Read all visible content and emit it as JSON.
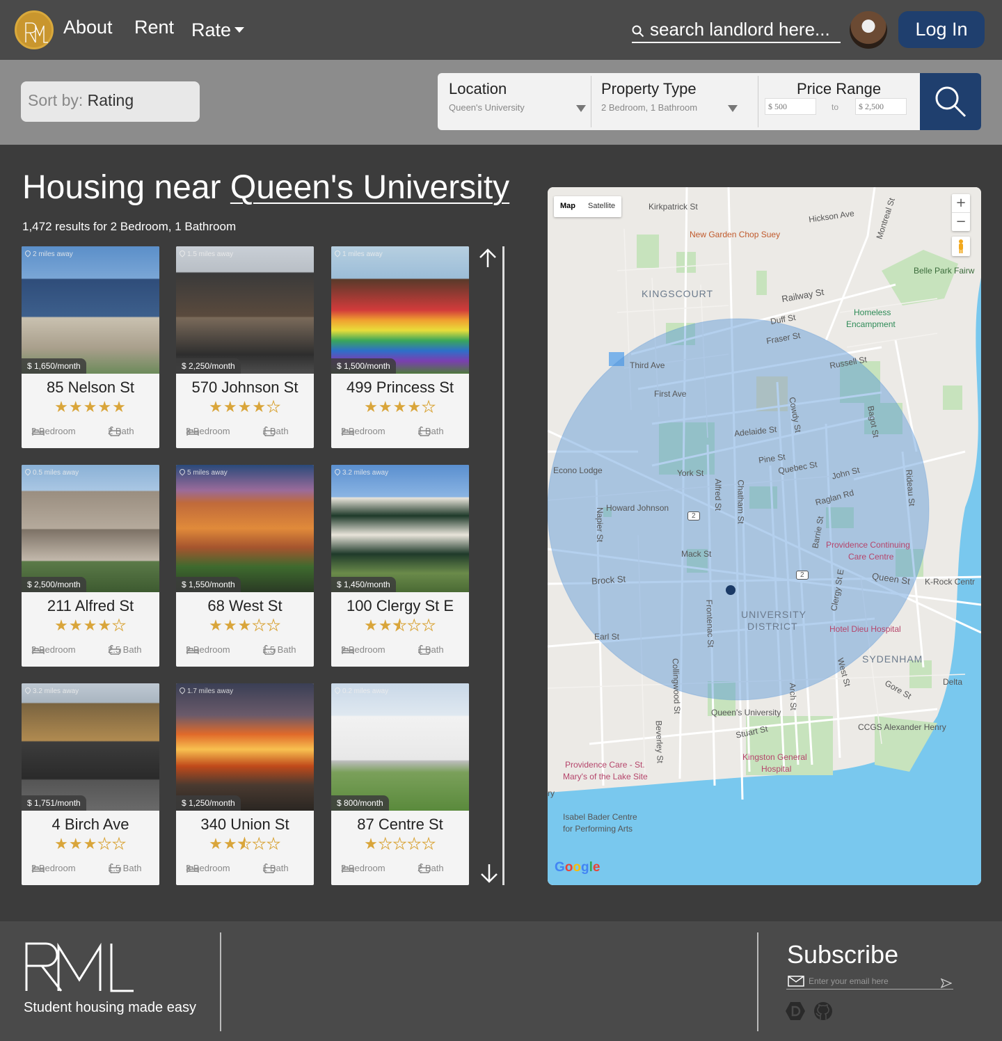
{
  "nav": {
    "links": [
      "About",
      "Rent",
      "Rate"
    ],
    "search_placeholder": "search landlord here...",
    "login_label": "Log In"
  },
  "filters": {
    "sort_prefix": "Sort by:",
    "sort_value": "Rating",
    "location_title": "Location",
    "location_value": "Queen's University",
    "property_title": "Property Type",
    "property_value": "2 Bedroom, 1 Bathroom",
    "price_title": "Price Range",
    "price_min": "$ 500",
    "price_to": "to",
    "price_max": "$ 2,500"
  },
  "main": {
    "title_prefix": "Housing near",
    "title_place": "Queen's University",
    "results": "1,472 results for 2 Bedroom, 1 Bathroom"
  },
  "listings": [
    {
      "address": "85 Nelson St",
      "distance": "2 miles away",
      "price": "$ 1,650/month",
      "rating": 5,
      "bedrooms": "2 Bedroom",
      "baths": "2 Bath"
    },
    {
      "address": "570 Johnson St",
      "distance": "1.5 miles away",
      "price": "$ 2,250/month",
      "rating": 4,
      "bedrooms": "3 Bedroom",
      "baths": "1 Bath"
    },
    {
      "address": "499 Princess St",
      "distance": "1 miles away",
      "price": "$ 1,500/month",
      "rating": 4,
      "bedrooms": "2 Bedroom",
      "baths": "1 Bath"
    },
    {
      "address": "211 Alfred St",
      "distance": "0.5 miles away",
      "price": "$ 2,500/month",
      "rating": 4,
      "bedrooms": "2 Bedroom",
      "baths": "2.5 Bath"
    },
    {
      "address": "68 West St",
      "distance": "5 miles away",
      "price": "$ 1,550/month",
      "rating": 3,
      "bedrooms": "2 Bedroom",
      "baths": "1.5 Bath"
    },
    {
      "address": "100 Clergy St E",
      "distance": "3.2 miles away",
      "price": "$ 1,450/month",
      "rating": 2.5,
      "bedrooms": "2 Bedroom",
      "baths": "1 Bath"
    },
    {
      "address": "4 Birch Ave",
      "distance": "3.2 miles away",
      "price": "$ 1,751/month",
      "rating": 3,
      "bedrooms": "2 Bedroom",
      "baths": "1.5 Bath"
    },
    {
      "address": "340 Union St",
      "distance": "1.7 miles away",
      "price": "$ 1,250/month",
      "rating": 2.5,
      "bedrooms": "3 Bedroom",
      "baths": "1 Bath"
    },
    {
      "address": "87 Centre St",
      "distance": "0.2 miles away",
      "price": "$ 800/month",
      "rating": 1,
      "bedrooms": "2 Bedroom",
      "baths": "2 Bath"
    }
  ],
  "map": {
    "toggle": [
      "Map",
      "Satellite"
    ],
    "labels": {
      "kirkpatrick": "Kirkpatrick St",
      "hickson": "Hickson Ave",
      "montreal": "Montreal St",
      "newgarden": "New Garden Chop Suey",
      "bellepark": "Belle Park Fairw",
      "kingscourt": "KINGSCOURT",
      "railway": "Railway St",
      "homeless1": "Homeless",
      "homeless2": "Encampment",
      "duff": "Duff St",
      "fraser": "Fraser St",
      "russell": "Russell St",
      "third": "Third Ave",
      "first": "First Ave",
      "cowdy": "Cowdy St",
      "bagot": "Bagot St",
      "adelaide": "Adelaide St",
      "econo": "Econo Lodge",
      "york": "York St",
      "pine": "Pine St",
      "quebec": "Quebec St",
      "john": "John St",
      "rideau": "Rideau St",
      "alfred": "Alfred St",
      "chatham": "Chatham St",
      "howard": "Howard Johnson",
      "raglan": "Raglan Rd",
      "napier": "Napier St",
      "barrie": "Barrie St",
      "providence1": "Providence Continuing",
      "providence2": "Care Centre",
      "mack": "Mack St",
      "queen": "Queen St",
      "krock": "K-Rock Centr",
      "brock": "Brock St",
      "clergy": "Clergy St E",
      "univ1": "UNIVERSITY",
      "univ2": "DISTRICT",
      "frontenac": "Frontenac St",
      "hoteldieu": "Hotel Dieu Hospital",
      "earl": "Earl St",
      "sydenham": "SYDENHAM",
      "west": "West St",
      "delta": "Delta",
      "gore": "Gore St",
      "collingwood": "Collingwood St",
      "arch": "Arch St",
      "queens": "Queen's University",
      "ccgs": "CCGS Alexander Henry",
      "stuart": "Stuart St",
      "kgh1": "Kingston General",
      "kgh2": "Hospital",
      "beverley": "Beverley St",
      "pcare1": "Providence Care - St.",
      "pcare2": "Mary's of the Lake Site",
      "ry": "ry",
      "isabel1": "Isabel Bader Centre",
      "isabel2": "for Performing Arts",
      "google": "Google",
      "hwy2": "2"
    }
  },
  "footer": {
    "tagline": "Student housing made easy",
    "subscribe_title": "Subscribe",
    "email_placeholder": "Enter your email here"
  }
}
